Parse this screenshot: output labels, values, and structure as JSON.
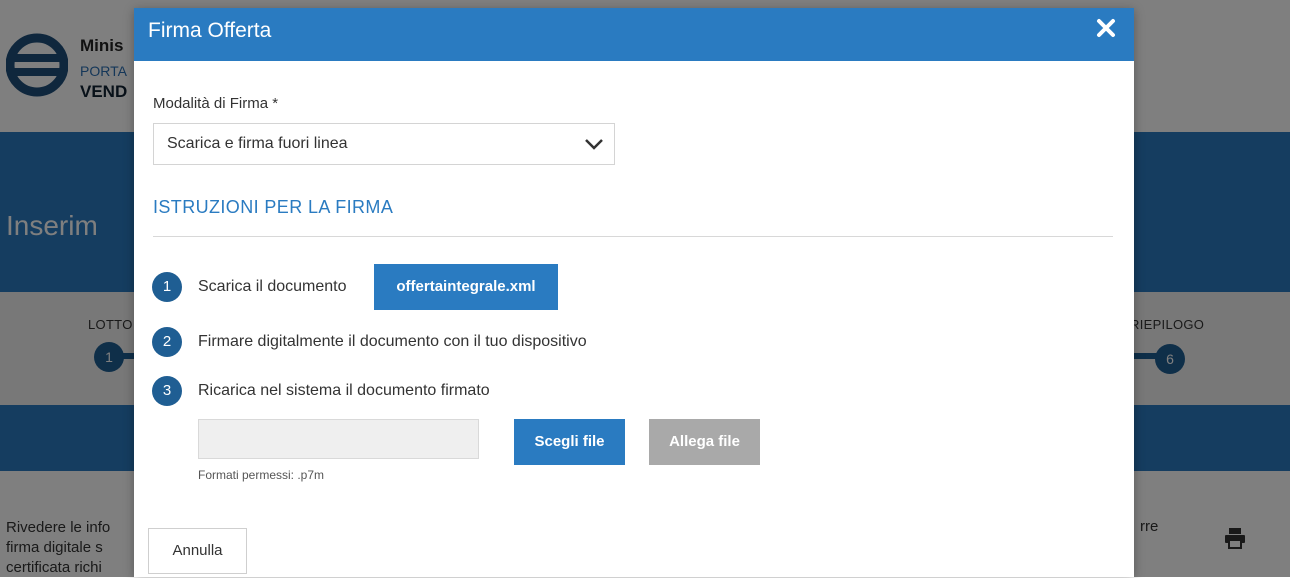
{
  "background": {
    "logo_lines": [
      "Minis",
      "PORTA",
      "VEND"
    ],
    "banner_title": "Inserim",
    "steps": {
      "left_label": "LOTTO",
      "left_number": "1",
      "right_label": "RIEPILOGO",
      "right_number": "6"
    },
    "text_lines": [
      "Rivedere le info",
      "firma digitale s",
      "certificata richi"
    ],
    "text_right": "rre",
    "print_icon": "printer-icon"
  },
  "modal": {
    "title": "Firma Offerta",
    "close_icon": "close-icon",
    "signature_mode": {
      "label": "Modalità di Firma  *",
      "selected": "Scarica e firma fuori linea"
    },
    "instructions_title": "ISTRUZIONI PER LA FIRMA",
    "steps": [
      {
        "number": "1",
        "text": "Scarica il documento"
      },
      {
        "number": "2",
        "text": "Firmare digitalmente il documento con il tuo dispositivo"
      },
      {
        "number": "3",
        "text": "Ricarica nel sistema il documento firmato"
      }
    ],
    "download_button": "offertaintegrale.xml",
    "upload": {
      "file_value": "",
      "choose_button": "Scegli file",
      "attach_button": "Allega file",
      "formats_note": "Formati permessi: .p7m"
    },
    "cancel_button": "Annulla"
  },
  "colors": {
    "primary": "#2a7bc1",
    "step_circle": "#1f5e93",
    "disabled_button": "#a9a9a9"
  }
}
